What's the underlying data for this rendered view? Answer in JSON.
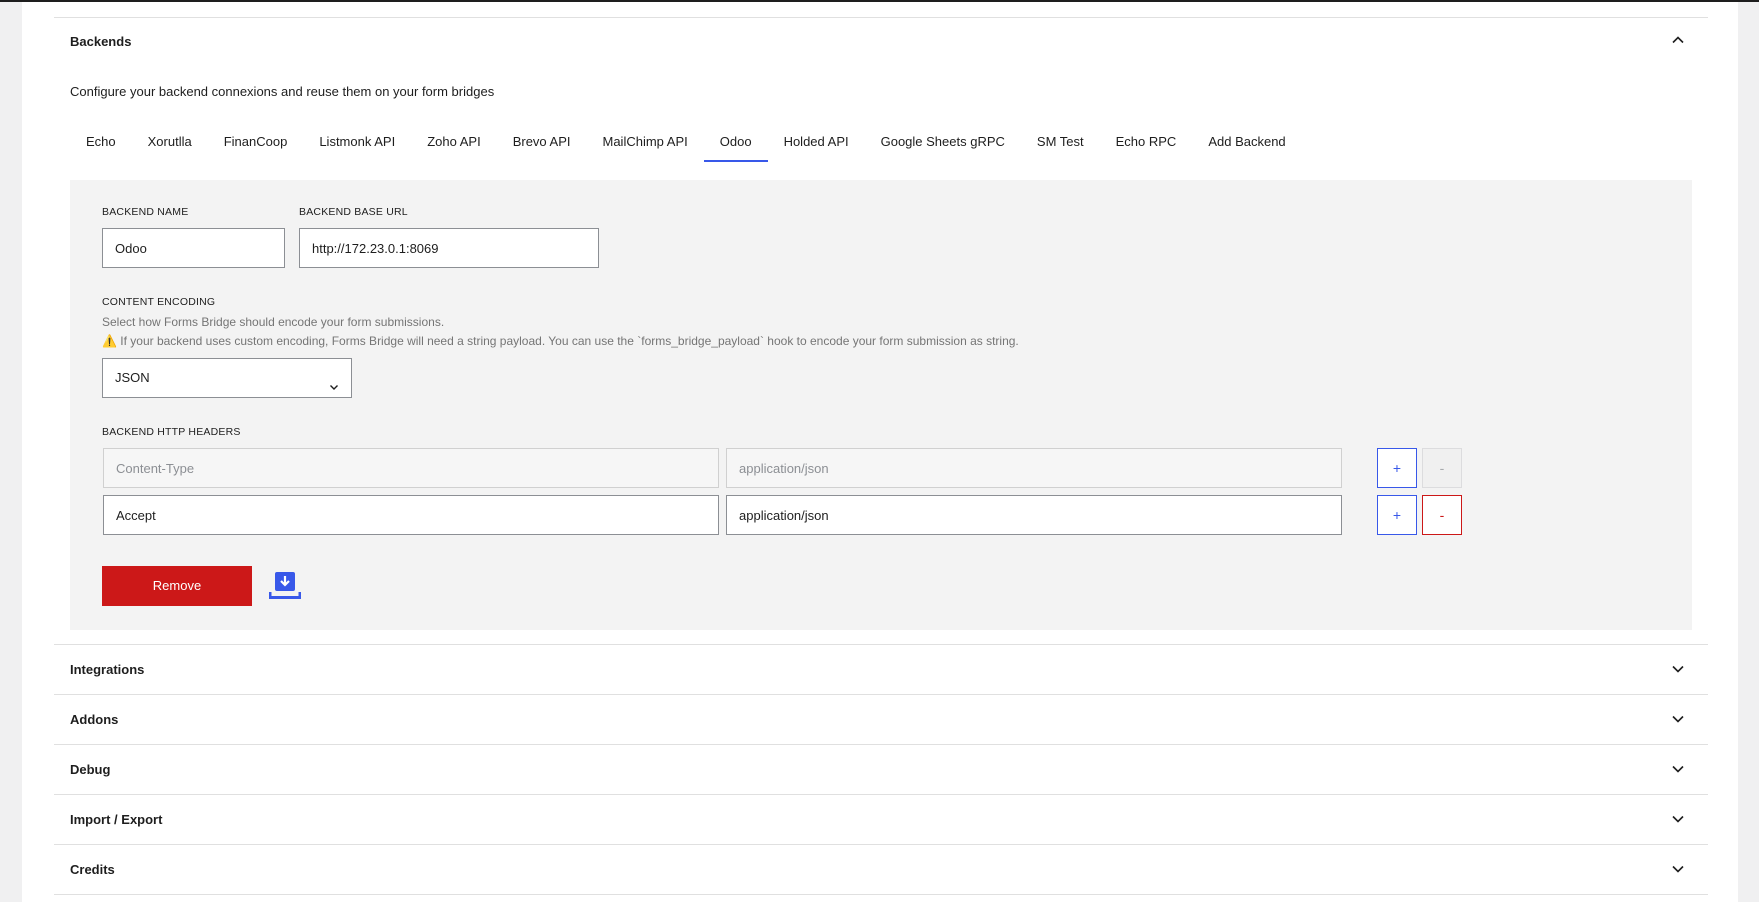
{
  "backends": {
    "title": "Backends",
    "description": "Configure your backend connexions and reuse them on your form bridges",
    "tabs": [
      "Echo",
      "Xorutlla",
      "FinanCoop",
      "Listmonk API",
      "Zoho API",
      "Brevo API",
      "MailChimp API",
      "Odoo",
      "Holded API",
      "Google Sheets gRPC",
      "SM Test",
      "Echo RPC",
      "Add Backend"
    ],
    "active_tab": "Odoo"
  },
  "form": {
    "name_label": "BACKEND NAME",
    "name_value": "Odoo",
    "url_label": "BACKEND BASE URL",
    "url_value": "http://172.23.0.1:8069",
    "encoding_label": "CONTENT ENCODING",
    "encoding_help": "Select how Forms Bridge should encode your form submissions.",
    "encoding_warning": "⚠️ If your backend uses custom encoding, Forms Bridge will need a string payload. You can use the `forms_bridge_payload` hook to encode your form submission as string.",
    "encoding_value": "JSON",
    "headers_label": "BACKEND HTTP HEADERS",
    "headers": [
      {
        "name": "Content-Type",
        "value": "application/json",
        "locked": true
      },
      {
        "name": "Accept",
        "value": "application/json",
        "locked": false
      }
    ],
    "add_label": "+",
    "remove_row_label": "-",
    "remove_label": "Remove",
    "download_icon": "download-icon"
  },
  "sections": [
    "Integrations",
    "Addons",
    "Debug",
    "Import / Export",
    "Credits"
  ],
  "colors": {
    "accent": "#3858e9",
    "danger": "#cc1818"
  }
}
